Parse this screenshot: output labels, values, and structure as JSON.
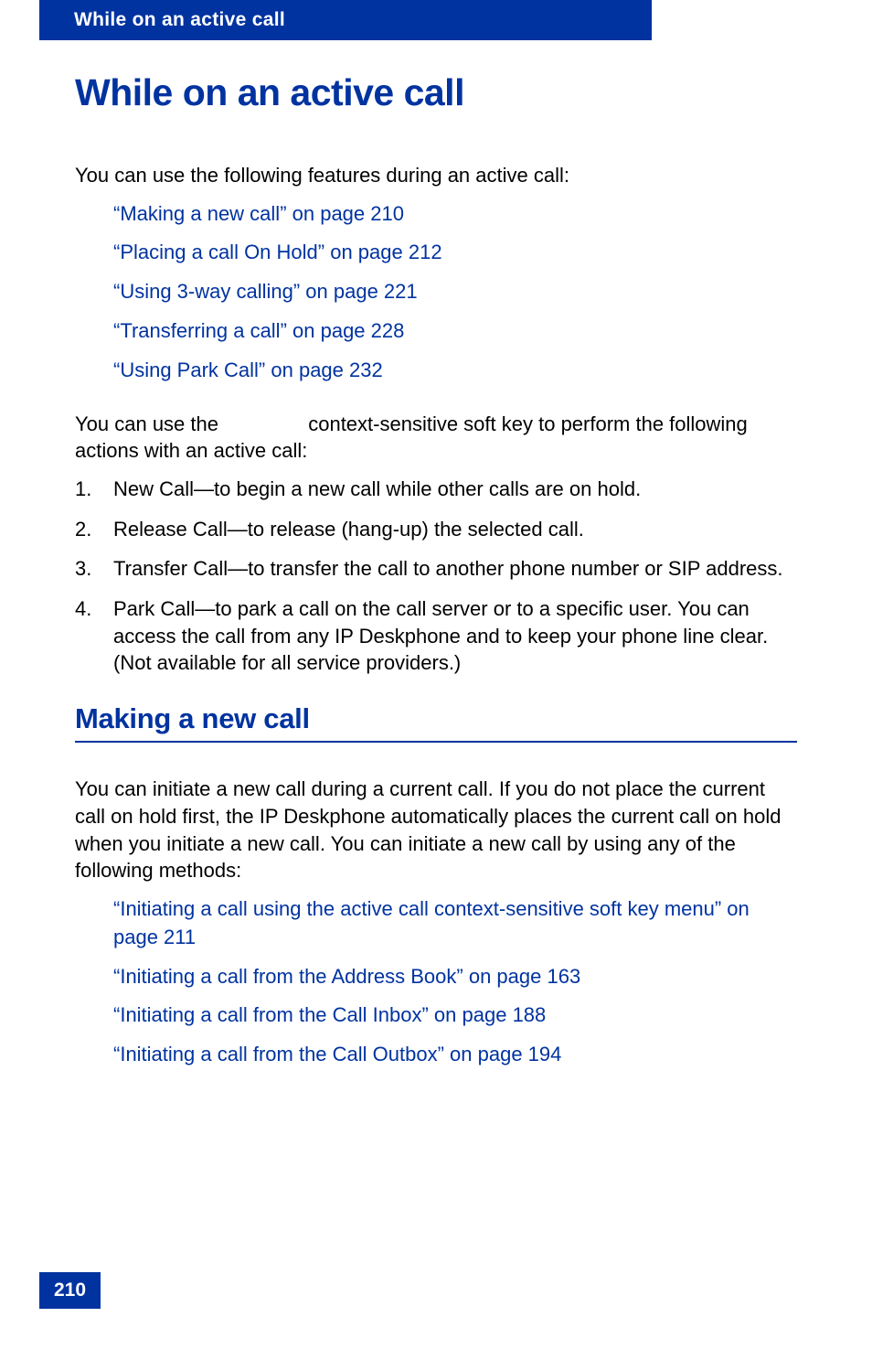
{
  "header": {
    "running_title": "While on an active call"
  },
  "chapter": {
    "title": "While on an active call"
  },
  "intro": {
    "text": "You can use the following features during an active call:"
  },
  "feature_links": [
    "“Making a new call” on page 210",
    "“Placing a call On Hold” on page 212",
    "“Using 3-way calling” on page 221",
    "“Transferring a call” on page 228",
    "“Using Park Call” on page 232"
  ],
  "softkey_para": {
    "part1": "You can use the ",
    "part2": " context-sensitive soft key to perform the following actions with an active call:"
  },
  "actions": [
    "New Call—to begin a new call while other calls are on hold.",
    "Release Call—to release (hang-up) the selected call.",
    "Transfer Call—to transfer the call to another phone number or SIP address.",
    "Park Call—to park a call on the call server or to a specific user. You can access the call from any IP Deskphone and to keep your phone line clear. (Not available for all service providers.)"
  ],
  "section": {
    "title": "Making a new call",
    "body": "You can initiate a new call during a current call. If you do not place the current call on hold first, the IP Deskphone automatically places the current call on hold when you initiate a new call. You can initiate a new call by using any of the following methods:"
  },
  "method_links": [
    "“Initiating a call using the active call context-sensitive soft key menu” on page 211",
    "“Initiating a call from the Address Book” on page 163",
    "“Initiating a call from the Call Inbox” on page 188",
    "“Initiating a call from the Call Outbox” on page 194"
  ],
  "footer": {
    "page_number": "210"
  }
}
